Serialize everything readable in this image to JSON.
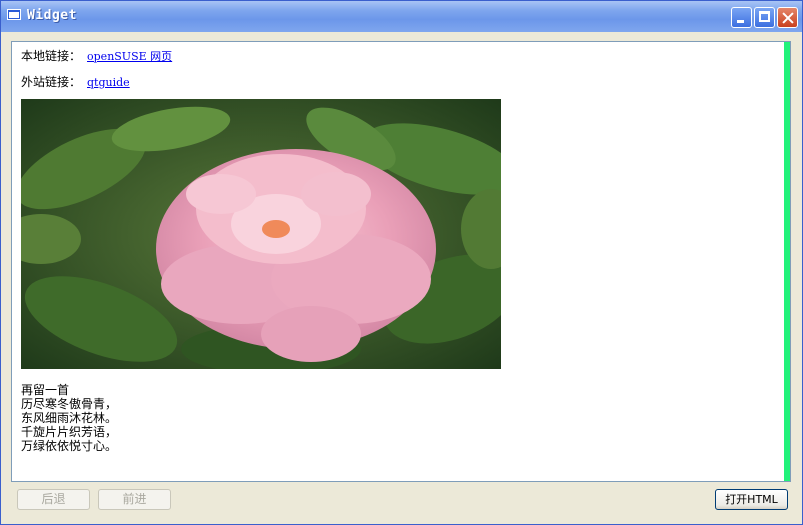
{
  "window": {
    "title": "Widget"
  },
  "browser": {
    "local_link_label": "本地链接：",
    "local_link_text": "openSUSE 网页",
    "external_link_label": "外站链接：",
    "external_link_text": "qtguide",
    "poem_lines": [
      "再留一首",
      "历尽寒冬傲骨青，",
      "东风细雨沐花林。",
      "千旋片片织芳语，",
      "万绿依依悦寸心。"
    ]
  },
  "buttons": {
    "back": "后退",
    "forward": "前进",
    "open_html": "打开HTML"
  },
  "colors": {
    "scrollbar": "#21f27a",
    "link": "#0000ee",
    "titlebar": "#6c97ea"
  }
}
